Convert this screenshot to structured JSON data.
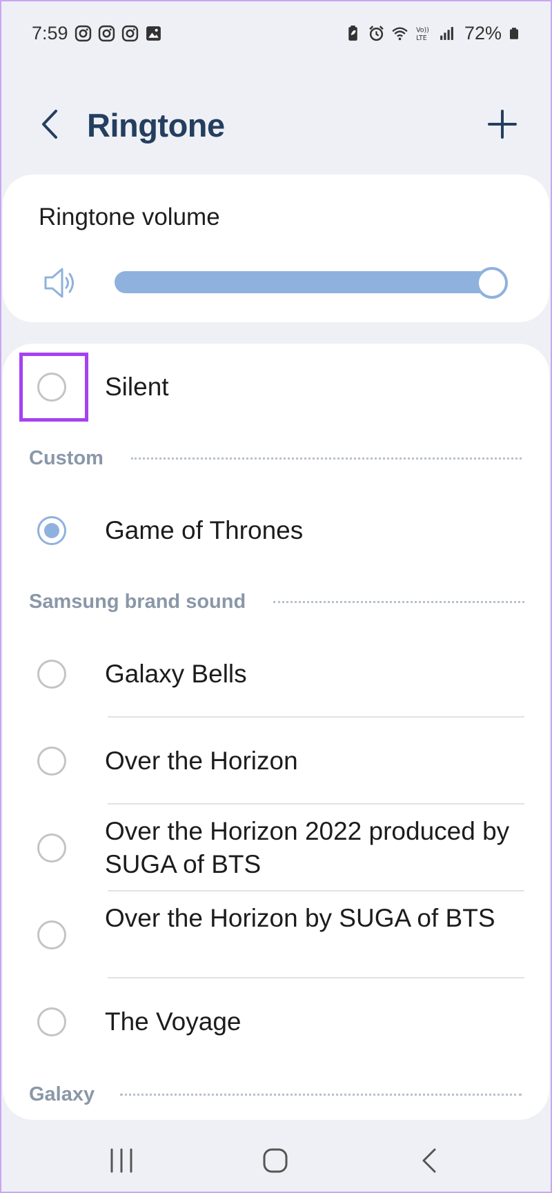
{
  "status_bar": {
    "time": "7:59",
    "battery": "72%",
    "left_icons": [
      "instagram-icon",
      "instagram-icon",
      "instagram-icon",
      "gallery-icon"
    ],
    "right_icons": [
      "battery-saver-icon",
      "alarm-icon",
      "wifi-icon",
      "volte-icon",
      "signal-icon",
      "battery-icon"
    ]
  },
  "header": {
    "title": "Ringtone",
    "back_icon": "chevron-left-icon",
    "add_icon": "plus-icon"
  },
  "volume": {
    "label": "Ringtone volume",
    "icon": "speaker-icon",
    "level": 1.0
  },
  "list": {
    "silent": {
      "label": "Silent",
      "selected": false
    },
    "sections": [
      {
        "header": "Custom",
        "items": [
          {
            "label": "Game of Thrones",
            "selected": true
          }
        ]
      },
      {
        "header": "Samsung brand sound",
        "items": [
          {
            "label": "Galaxy Bells",
            "selected": false
          },
          {
            "label": "Over the Horizon",
            "selected": false
          },
          {
            "label": "Over the Horizon 2022 produced by SUGA of BTS",
            "selected": false
          },
          {
            "label": "Over the Horizon by SUGA of BTS",
            "selected": false
          },
          {
            "label": "The Voyage",
            "selected": false
          }
        ]
      },
      {
        "header": "Galaxy",
        "items": []
      }
    ]
  },
  "colors": {
    "accent": "#8fb1dd",
    "title": "#243e5f",
    "section_header": "#8a97a8",
    "highlight": "#a542f0",
    "background": "#eef0f5"
  },
  "nav_bar": {
    "icons": [
      "recents-icon",
      "home-icon",
      "back-icon"
    ]
  }
}
